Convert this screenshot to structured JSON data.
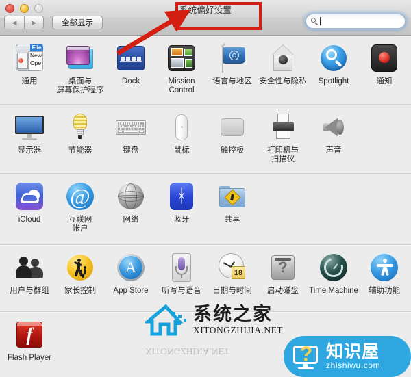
{
  "window": {
    "title": "系统偏好设置",
    "traffic_lights": [
      "close",
      "minimize",
      "zoom"
    ],
    "nav_back": "◀",
    "nav_forward": "▶",
    "show_all_label": "全部显示",
    "search": {
      "value": "",
      "placeholder": ""
    }
  },
  "annotation": {
    "rect_color": "#d31f11",
    "arrow_color": "#d31f11",
    "target": "系统偏好设置"
  },
  "groups": [
    {
      "id": "personal",
      "items": [
        {
          "name": "通用",
          "icon": "general-icon"
        },
        {
          "name": "桌面与\n屏幕保护程序",
          "icon": "desktop-screensaver-icon"
        },
        {
          "name": "Dock",
          "icon": "dock-icon"
        },
        {
          "name": "Mission\nControl",
          "icon": "mission-control-icon"
        },
        {
          "name": "语言与地区",
          "icon": "language-region-icon"
        },
        {
          "name": "安全性与隐私",
          "icon": "security-privacy-icon"
        },
        {
          "name": "Spotlight",
          "icon": "spotlight-icon"
        },
        {
          "name": "通知",
          "icon": "notifications-icon"
        }
      ]
    },
    {
      "id": "hardware",
      "items": [
        {
          "name": "显示器",
          "icon": "displays-icon"
        },
        {
          "name": "节能器",
          "icon": "energy-saver-icon"
        },
        {
          "name": "键盘",
          "icon": "keyboard-icon"
        },
        {
          "name": "鼠标",
          "icon": "mouse-icon"
        },
        {
          "name": "触控板",
          "icon": "trackpad-icon"
        },
        {
          "name": "打印机与\n扫描仪",
          "icon": "printers-scanners-icon"
        },
        {
          "name": "声音",
          "icon": "sound-icon"
        }
      ]
    },
    {
      "id": "internet",
      "items": [
        {
          "name": "iCloud",
          "icon": "icloud-icon"
        },
        {
          "name": "互联网\n帐户",
          "icon": "internet-accounts-icon"
        },
        {
          "name": "网络",
          "icon": "network-icon"
        },
        {
          "name": "蓝牙",
          "icon": "bluetooth-icon"
        },
        {
          "name": "共享",
          "icon": "sharing-icon"
        }
      ]
    },
    {
      "id": "system",
      "items": [
        {
          "name": "用户与群组",
          "icon": "users-groups-icon"
        },
        {
          "name": "家长控制",
          "icon": "parental-controls-icon"
        },
        {
          "name": "App Store",
          "icon": "app-store-icon"
        },
        {
          "name": "听写与语音",
          "icon": "dictation-speech-icon"
        },
        {
          "name": "日期与时间",
          "icon": "date-time-icon"
        },
        {
          "name": "启动磁盘",
          "icon": "startup-disk-icon"
        },
        {
          "name": "Time Machine",
          "icon": "time-machine-icon"
        },
        {
          "name": "辅助功能",
          "icon": "accessibility-icon"
        }
      ]
    },
    {
      "id": "other",
      "items": [
        {
          "name": "Flash Player",
          "icon": "flash-player-icon"
        }
      ]
    }
  ],
  "icon_text": {
    "general_file": "File",
    "general_menu": "New\nOpe",
    "date_day": "18",
    "at_symbol": "@",
    "bluetooth_glyph": "ᚼ",
    "app_store_glyph": "A",
    "disk_glyph": "?",
    "flash_glyph": "f"
  },
  "watermarks": {
    "xitongzhijia": {
      "cn": "系统之家",
      "en": "XITONGZHIJIA.NET"
    },
    "zhishiwu": {
      "cn": "知识屋",
      "en": "zhishiwu.com",
      "bg": "#2ea7e0"
    }
  }
}
